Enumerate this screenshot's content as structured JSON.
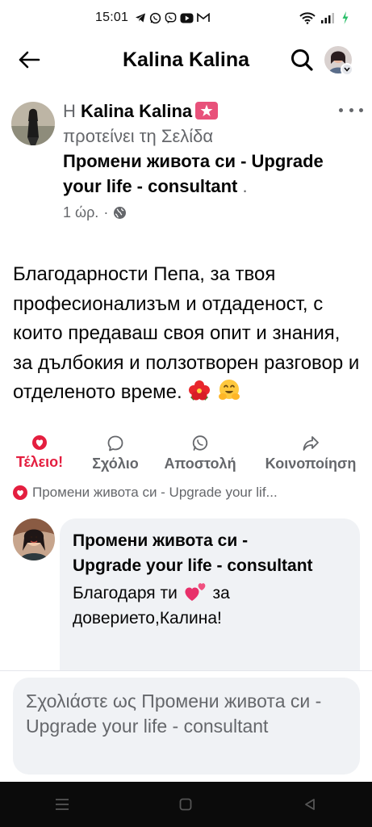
{
  "status_bar": {
    "time": "15:01",
    "icons": [
      "telegram-icon",
      "whatsapp-icon",
      "viber-icon",
      "youtube-icon",
      "gmail-icon"
    ],
    "right_icons": [
      "wifi-icon",
      "signal-icon",
      "battery-charging-icon"
    ]
  },
  "header": {
    "title": "Kalina Kalina"
  },
  "post": {
    "article": "Η",
    "author": "Kalina Kalina",
    "action": "προτείνει τη Σελίδα",
    "page_name": "Промени живота си - Upgrade your life - consultant",
    "page_suffix": ".",
    "time": "1 ώρ.",
    "separator": "·",
    "body": "Благодарности Пепа, за твоя професионализъм и отдаденост, с които предаваш своя опит и знания, за дълбокия и ползотворен разговор и отделеното време."
  },
  "actions": {
    "like": "Τέλειο!",
    "comment": "Σχόλιο",
    "send": "Αποστολή",
    "share": "Κοινοποίηση"
  },
  "reactions": {
    "text": "Промени живота си - Upgrade your lif..."
  },
  "comment": {
    "author": "Промени живота си - Upgrade your life - consultant",
    "text_before": "Благодаря ти",
    "text_after": "за доверието,Калина!"
  },
  "composer": {
    "placeholder": "Σχολιάστε ως Промени живота си - Upgrade your life - consultant"
  },
  "colors": {
    "accent_red": "#e41e3f",
    "muted": "#65676b",
    "bubble": "#f0f2f5",
    "badge": "#e8517a"
  }
}
